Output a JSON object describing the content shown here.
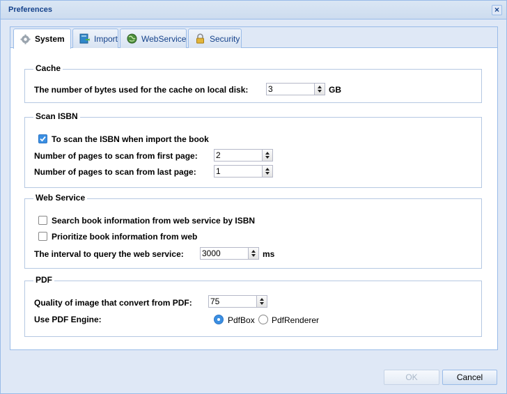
{
  "window": {
    "title": "Preferences"
  },
  "tabs": [
    {
      "label": "System",
      "icon": "gear-icon",
      "active": true
    },
    {
      "label": "Import",
      "icon": "import-icon",
      "active": false
    },
    {
      "label": "WebService",
      "icon": "globe-icon",
      "active": false
    },
    {
      "label": "Security",
      "icon": "lock-icon",
      "active": false
    }
  ],
  "cache": {
    "legend": "Cache",
    "bytes_label": "The number of bytes used for the cache on local disk:",
    "bytes_value": "3",
    "unit": "GB"
  },
  "scan_isbn": {
    "legend": "Scan ISBN",
    "scan_checkbox_label": "To scan the ISBN when import the book",
    "scan_checked": true,
    "first_label": "Number of pages to scan from first page:",
    "first_value": "2",
    "last_label": "Number of pages to scan from last page:",
    "last_value": "1"
  },
  "web_service": {
    "legend": "Web Service",
    "search_label": "Search book information from web service by ISBN",
    "search_checked": false,
    "prioritize_label": "Prioritize book information from web",
    "prioritize_checked": false,
    "interval_label": "The interval to query the web service:",
    "interval_value": "3000",
    "interval_unit": "ms"
  },
  "pdf": {
    "legend": "PDF",
    "quality_label": "Quality of image that convert from PDF:",
    "quality_value": "75",
    "engine_label": "Use PDF Engine:",
    "engine_options": [
      "PdfBox",
      "PdfRenderer"
    ],
    "engine_selected": "PdfBox"
  },
  "footer": {
    "ok_label": "OK",
    "cancel_label": "Cancel"
  },
  "colors": {
    "accent": "#3b8fe2",
    "title": "#15428b",
    "frame": "#dfe8f6"
  }
}
